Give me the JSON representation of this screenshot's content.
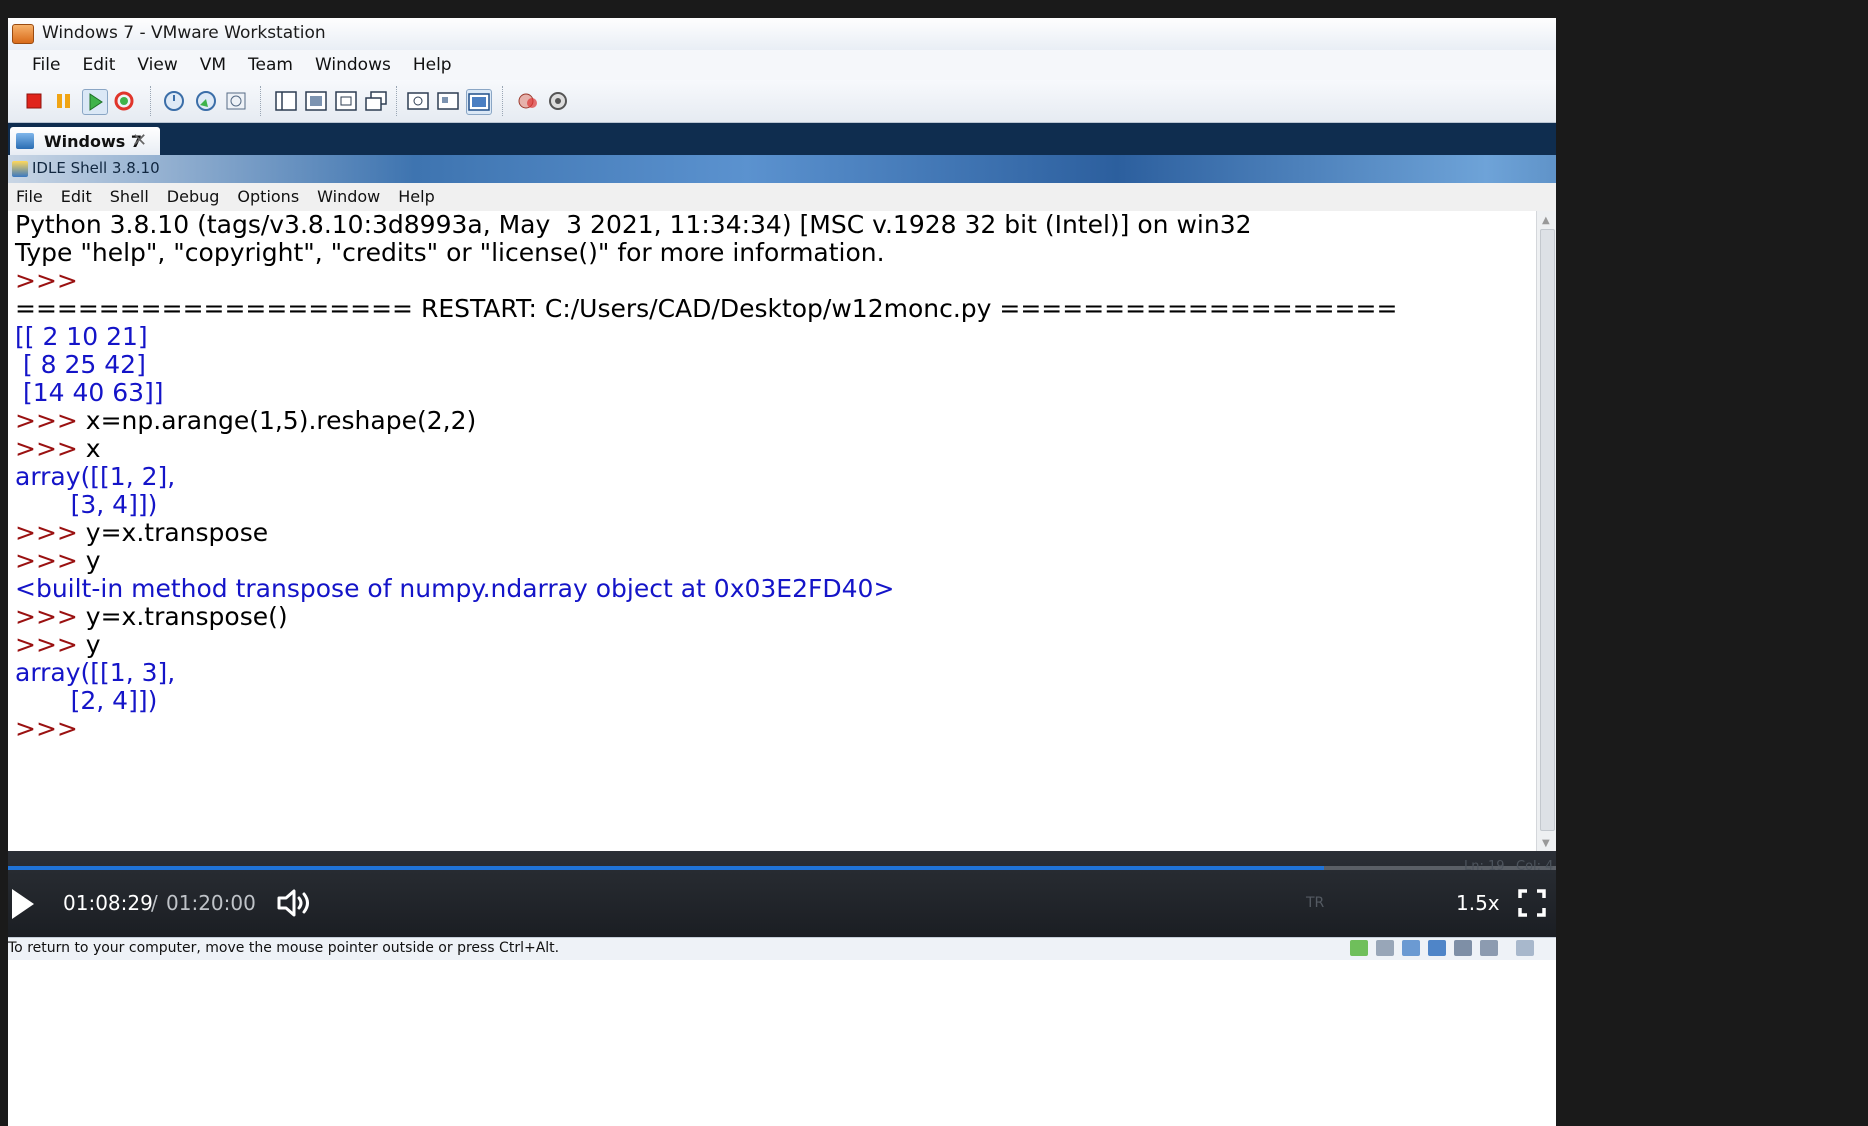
{
  "vmware": {
    "title": "Windows 7 - VMware Workstation",
    "menu": [
      "File",
      "Edit",
      "View",
      "VM",
      "Team",
      "Windows",
      "Help"
    ],
    "tab_label": "Windows 7",
    "tab_close": "✕",
    "status_message": "To return to your computer, move the mouse pointer outside or press Ctrl+Alt.",
    "window_buttons": {
      "minimize": "—",
      "restore": "❐",
      "close": "✕"
    }
  },
  "idle": {
    "title": "IDLE Shell 3.8.10",
    "menu": [
      "File",
      "Edit",
      "Shell",
      "Debug",
      "Options",
      "Window",
      "Help"
    ],
    "window_buttons": {
      "minimize": "—",
      "restore": "❐",
      "close": "✕"
    },
    "lines": [
      {
        "prompt": "",
        "text": "Python 3.8.10 (tags/v3.8.10:3d8993a, May  3 2021, 11:34:34) [MSC v.1928 32 bit (Intel)] on win32",
        "style": "normal"
      },
      {
        "prompt": "",
        "text": "Type \"help\", \"copyright\", \"credits\" or \"license()\" for more information.",
        "style": "normal"
      },
      {
        "prompt": ">>>",
        "text": "",
        "style": "normal"
      },
      {
        "prompt": "",
        "text": "=================== RESTART: C:/Users/CAD/Desktop/w12monc.py ===================",
        "style": "normal"
      },
      {
        "prompt": "",
        "text": "[[ 2 10 21]",
        "style": "blue"
      },
      {
        "prompt": "",
        "text": " [ 8 25 42]",
        "style": "blue"
      },
      {
        "prompt": "",
        "text": " [14 40 63]]",
        "style": "blue"
      },
      {
        "prompt": ">>>",
        "text": " x=np.arange(1,5).reshape(2,2)",
        "style": "normal"
      },
      {
        "prompt": ">>>",
        "text": " x",
        "style": "normal"
      },
      {
        "prompt": "",
        "text": "array([[1, 2],",
        "style": "blue"
      },
      {
        "prompt": "",
        "text": "       [3, 4]])",
        "style": "blue"
      },
      {
        "prompt": ">>>",
        "text": " y=x.transpose",
        "style": "normal"
      },
      {
        "prompt": ">>>",
        "text": " y",
        "style": "normal"
      },
      {
        "prompt": "",
        "text": "<built-in method transpose of numpy.ndarray object at 0x03E2FD40>",
        "style": "blue"
      },
      {
        "prompt": ">>>",
        "text": " y=x.transpose()",
        "style": "normal"
      },
      {
        "prompt": ">>>",
        "text": " y",
        "style": "normal"
      },
      {
        "prompt": "",
        "text": "array([[1, 3],",
        "style": "blue"
      },
      {
        "prompt": "",
        "text": "       [2, 4]])",
        "style": "blue"
      },
      {
        "prompt": ">>>",
        "text": "",
        "style": "normal"
      }
    ],
    "status": {
      "line": "Ln: 19",
      "col": "Col: 4"
    }
  },
  "player": {
    "current_time": "01:08:29",
    "separator": "/",
    "duration": "01:20:00",
    "speed": "1.5x",
    "progress": 0.85,
    "tray_lang": "TR"
  },
  "colors": {
    "output_blue": "#1414c8",
    "prompt_red": "#9a1111",
    "progress_blue": "#1f73d8"
  }
}
